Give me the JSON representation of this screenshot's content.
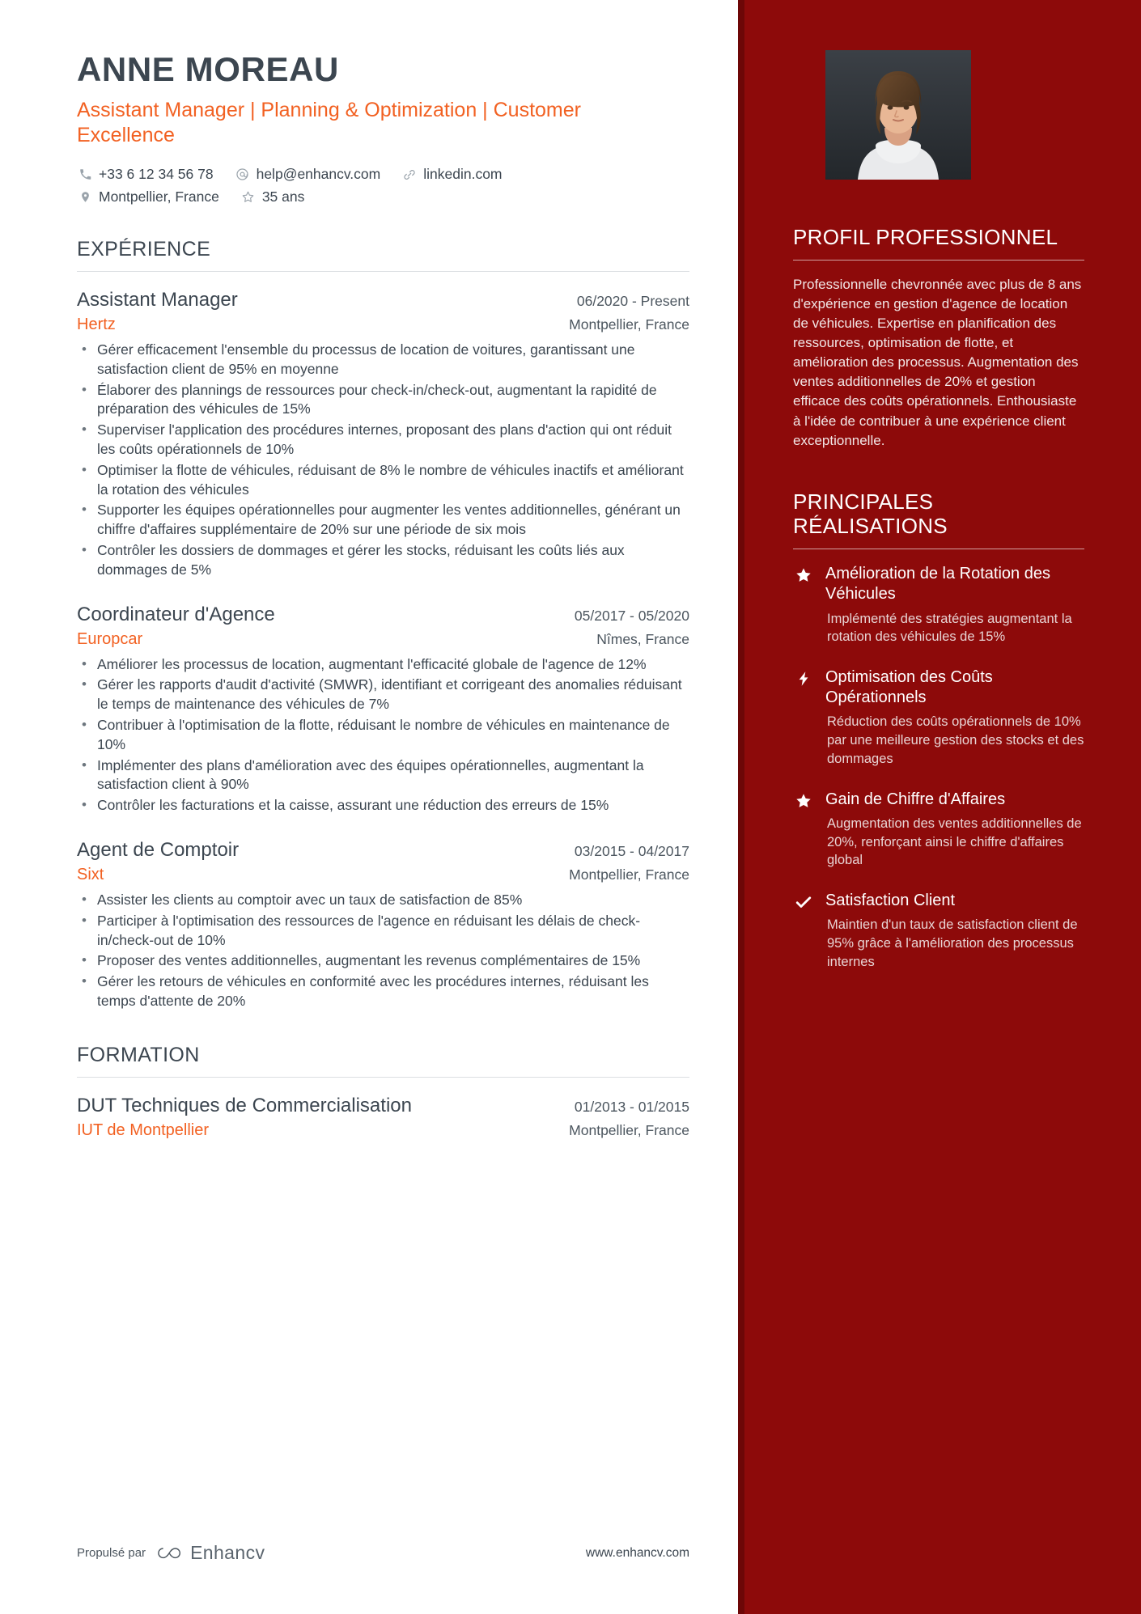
{
  "header": {
    "name": "ANNE MOREAU",
    "headline": "Assistant Manager | Planning & Optimization | Customer Excellence",
    "contacts_row1": [
      {
        "icon": "phone-icon",
        "text": "+33 6 12 34 56 78"
      },
      {
        "icon": "email-icon",
        "text": "help@enhancv.com"
      },
      {
        "icon": "link-icon",
        "text": "linkedin.com"
      }
    ],
    "contacts_row2": [
      {
        "icon": "location-pin-icon",
        "text": "Montpellier, France"
      },
      {
        "icon": "star-outline-icon",
        "text": "35 ans"
      }
    ]
  },
  "experience": {
    "title": "EXPÉRIENCE",
    "entries": [
      {
        "role": "Assistant Manager",
        "dates": "06/2020 - Present",
        "company": "Hertz",
        "location": "Montpellier, France",
        "bullets": [
          "Gérer efficacement l'ensemble du processus de location de voitures, garantissant une satisfaction client de 95% en moyenne",
          "Élaborer des plannings de ressources pour check-in/check-out, augmentant la rapidité de préparation des véhicules de 15%",
          "Superviser l'application des procédures internes, proposant des plans d'action qui ont réduit les coûts opérationnels de 10%",
          "Optimiser la flotte de véhicules, réduisant de 8% le nombre de véhicules inactifs et améliorant la rotation des véhicules",
          "Supporter les équipes opérationnelles pour augmenter les ventes additionnelles, générant un chiffre d'affaires supplémentaire de 20% sur une période de six mois",
          "Contrôler les dossiers de dommages et gérer les stocks, réduisant les coûts liés aux dommages de 5%"
        ]
      },
      {
        "role": "Coordinateur d'Agence",
        "dates": "05/2017 - 05/2020",
        "company": "Europcar",
        "location": "Nîmes, France",
        "bullets": [
          "Améliorer les processus de location, augmentant l'efficacité globale de l'agence de 12%",
          "Gérer les rapports d'audit d'activité (SMWR), identifiant et corrigeant des anomalies réduisant le temps de maintenance des véhicules de 7%",
          "Contribuer à l'optimisation de la flotte, réduisant le nombre de véhicules en maintenance de 10%",
          "Implémenter des plans d'amélioration avec des équipes opérationnelles, augmentant la satisfaction client à 90%",
          "Contrôler les facturations et la caisse, assurant une réduction des erreurs de 15%"
        ]
      },
      {
        "role": "Agent de Comptoir",
        "dates": "03/2015 - 04/2017",
        "company": "Sixt",
        "location": "Montpellier, France",
        "bullets": [
          "Assister les clients au comptoir avec un taux de satisfaction de 85%",
          "Participer à l'optimisation des ressources de l'agence en réduisant les délais de check-in/check-out de 10%",
          "Proposer des ventes additionnelles, augmentant les revenus complémentaires de 15%",
          "Gérer les retours de véhicules en conformité avec les procédures internes, réduisant les temps d'attente de 20%"
        ]
      }
    ]
  },
  "education": {
    "title": "FORMATION",
    "entries": [
      {
        "degree": "DUT Techniques de Commercialisation",
        "dates": "01/2013 - 01/2015",
        "school": "IUT de Montpellier",
        "location": "Montpellier, France"
      }
    ]
  },
  "sidebar": {
    "profile": {
      "title": "PROFIL PROFESSIONNEL",
      "text": "Professionnelle chevronnée avec plus de 8 ans d'expérience en gestion d'agence de location de véhicules. Expertise en planification des ressources, optimisation de flotte, et amélioration des processus. Augmentation des ventes additionnelles de 20% et gestion efficace des coûts opérationnels. Enthousiaste à l'idée de contribuer à une expérience client exceptionnelle."
    },
    "achievements": {
      "title": "PRINCIPALES RÉALISATIONS",
      "items": [
        {
          "icon": "star-icon",
          "title": "Amélioration de la Rotation des Véhicules",
          "desc": "Implémenté des stratégies augmentant la rotation des véhicules de 15%"
        },
        {
          "icon": "lightning-bolt-icon",
          "title": "Optimisation des Coûts Opérationnels",
          "desc": "Réduction des coûts opérationnels de 10% par une meilleure gestion des stocks et des dommages"
        },
        {
          "icon": "star-icon",
          "title": "Gain de Chiffre d'Affaires",
          "desc": "Augmentation des ventes additionnelles de 20%, renforçant ainsi le chiffre d'affaires global"
        },
        {
          "icon": "checkmark-icon",
          "title": "Satisfaction Client",
          "desc": "Maintien d'un taux de satisfaction client de 95% grâce à l'amélioration des processus internes"
        }
      ]
    }
  },
  "footer": {
    "powered_by": "Propulsé par",
    "brand": "Enhancv",
    "url": "www.enhancv.com"
  },
  "colors": {
    "accent_orange": "#f26122",
    "sidebar_red": "#8d0a0a",
    "sidebar_edge": "#6d0707",
    "text_dark": "#3c4650"
  }
}
